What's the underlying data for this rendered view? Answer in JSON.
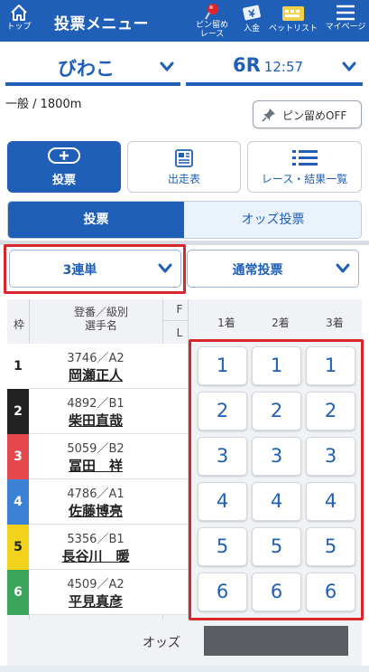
{
  "header": {
    "home_label": "トップ",
    "title": "投票メニュー",
    "pin_label_1": "ピン留め",
    "pin_label_2": "レース",
    "deposit_label": "入金",
    "betlist_label": "ベットリスト",
    "mypage_label": "マイページ"
  },
  "race": {
    "venue": "びわこ",
    "race_no": "6R",
    "time": "12:57",
    "info": "一般 / 1800m",
    "pin_off_label": "ピン留めOFF"
  },
  "nav": {
    "vote_label": "投票",
    "racecard_label": "出走表",
    "results_label": "レース・結果一覧"
  },
  "tabs": {
    "vote": "投票",
    "odds": "オッズ投票"
  },
  "bet": {
    "type": "3連単",
    "method": "通常投票"
  },
  "table": {
    "col_waku": "枠",
    "col_id_line1": "登番／級別",
    "col_id_line2": "選手名",
    "col_f": "F",
    "col_l": "L",
    "col_1": "1着",
    "col_2": "2着",
    "col_3": "3着",
    "rows": [
      {
        "waku": "1",
        "num": "3746／A2",
        "name": "岡瀬正人",
        "p1": "1",
        "p2": "1",
        "p3": "1"
      },
      {
        "waku": "2",
        "num": "4892／B1",
        "name": "柴田直哉",
        "p1": "2",
        "p2": "2",
        "p3": "2"
      },
      {
        "waku": "3",
        "num": "5059／B2",
        "name": "冨田　祥",
        "p1": "3",
        "p2": "3",
        "p3": "3"
      },
      {
        "waku": "4",
        "num": "4786／A1",
        "name": "佐藤博亮",
        "p1": "4",
        "p2": "4",
        "p3": "4"
      },
      {
        "waku": "5",
        "num": "5356／B1",
        "name": "長谷川　暖",
        "p1": "5",
        "p2": "5",
        "p3": "5"
      },
      {
        "waku": "6",
        "num": "4509／A2",
        "name": "平見真彦",
        "p1": "6",
        "p2": "6",
        "p3": "6"
      }
    ],
    "odds_label": "オッズ"
  },
  "colors": {
    "brand": "#1f5fb8",
    "highlight": "#d9262b",
    "waku_1": "#ffffff",
    "waku_2": "#222222",
    "waku_3": "#e5484d",
    "waku_4": "#3b82d6",
    "waku_5": "#f2d21b",
    "waku_6": "#3aa55a"
  }
}
